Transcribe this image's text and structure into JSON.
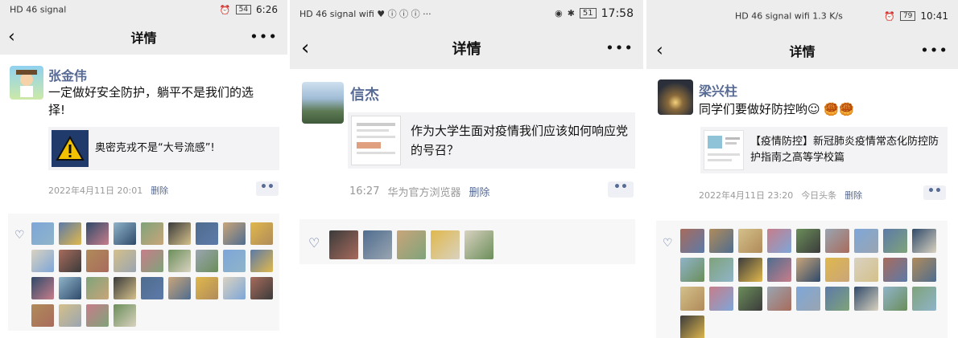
{
  "panels": [
    {
      "status": {
        "icons_left": "HD 46 signal",
        "battery": "54",
        "time": "6:26"
      },
      "nav": {
        "back": "‹",
        "title": "详情",
        "more": "•••"
      },
      "post": {
        "author": "张金伟",
        "text": "一定做好安全防护，躺平不是我们的选择!",
        "share_title": "奥密克戎不是“大号流感”!",
        "date": "2022年4月11日 20:01",
        "delete": "删除"
      },
      "likes": {
        "count": 31
      }
    },
    {
      "status": {
        "icons_left": "HD 46 signal wifi ♥ ⓘ ⓘ ⓘ ···",
        "battery": "51",
        "time": "17:58"
      },
      "nav": {
        "back": "‹",
        "title": "详情",
        "more": "•••"
      },
      "post": {
        "author": "信杰",
        "share_title": "作为大学生面对疫情我们应该如何响应党的号召？",
        "time": "16:27",
        "source": "华为官方浏览器",
        "delete": "删除"
      },
      "likes": {
        "count": 5
      }
    },
    {
      "status": {
        "icons_left": "HD 46 signal wifi 1.3 K/s",
        "battery": "79",
        "time": "10:41"
      },
      "nav": {
        "back": "‹",
        "title": "详情",
        "more": "•••"
      },
      "post": {
        "author": "梁兴柱",
        "text": "同学们要做好防控哟☺ 🥮🥮",
        "share_title": "【疫情防控】新冠肺炎疫情常态化防控防护指南之高等学校篇",
        "date": "2022年4月11日 23:20",
        "source": "今日头条",
        "delete": "删除"
      },
      "likes": {
        "count": 28
      }
    }
  ],
  "colors": {
    "name_blue": "#576b95",
    "bar_gray": "#ededed",
    "card_gray": "#f3f3f5",
    "likes_bg": "#f7f7f7",
    "avatar_palette": [
      "#7ea6d8",
      "#c9a57a",
      "#6b8e5a",
      "#3b3b3b",
      "#d4c08a",
      "#8fb4c9",
      "#a86b5c",
      "#5c7aa8",
      "#e0b84c",
      "#9aa5b1",
      "#4f6d8f",
      "#c77d8a",
      "#7fa37a",
      "#b08b5a",
      "#2f4a6a",
      "#d9d2c0"
    ]
  }
}
